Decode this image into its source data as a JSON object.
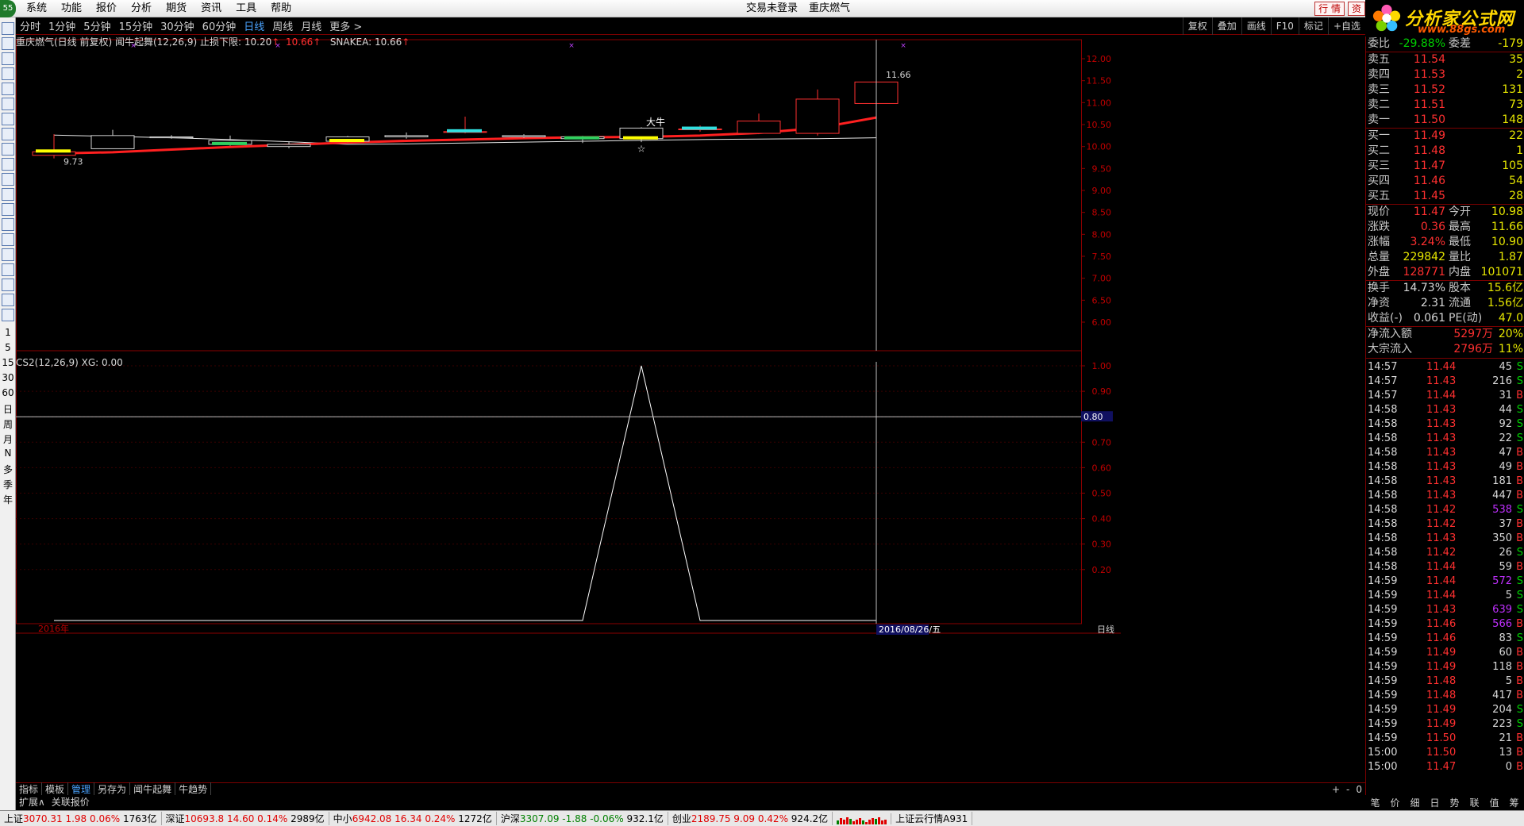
{
  "menubar": {
    "badge": "55",
    "items": [
      "系统",
      "功能",
      "报价",
      "分析",
      "期货",
      "资讯",
      "工具",
      "帮助"
    ],
    "login_status": "交易未登录",
    "stock_name": "重庆燃气",
    "right_buttons": [
      "行 情",
      "资"
    ]
  },
  "logo": {
    "title": "分析家公式网",
    "url": "www.88gs.com"
  },
  "periodbar": {
    "periods": [
      "分时",
      "1分钟",
      "5分钟",
      "15分钟",
      "30分钟",
      "60分钟",
      "日线",
      "周线",
      "月线",
      "更多 >"
    ],
    "active_index": 6,
    "right_tools": [
      "复权",
      "叠加",
      "画线",
      "F10",
      "标记",
      "+自选"
    ]
  },
  "lefttool": {
    "labels": [
      "1",
      "5",
      "15",
      "30",
      "60",
      "日",
      "周",
      "月",
      "N",
      "多",
      "季",
      "年"
    ],
    "icon_names": [
      "cursor-icon",
      "arrow-down-icon",
      "zoom-icon",
      "grid-icon",
      "line-chart-icon",
      "kline-icon",
      "table-icon",
      "f10-icon",
      "f10b-icon",
      "news-icon",
      "f10c-icon",
      "f10d-icon",
      "gauge-icon",
      "trend-icon",
      "rsi-icon",
      "money-icon",
      "move-icon",
      "pencil-icon",
      "fs-icon",
      "refresh-icon"
    ]
  },
  "main_chart": {
    "info": {
      "title": "重庆燃气(日线 前复权) 闻牛起舞(12,26,9)",
      "stop_loss_label": "止损下限:",
      "stop_loss_value": "10.20",
      "value2": "10.66",
      "snake_label": "SNAKEA:",
      "snake_value": "10.66"
    },
    "high_label": "11.66",
    "low_label": "9.73",
    "signal_label": "大牛",
    "y_ticks": [
      "12.00",
      "11.50",
      "11.00",
      "10.50",
      "10.00",
      "9.50",
      "9.00",
      "8.50",
      "8.00",
      "7.50",
      "7.00",
      "6.50",
      "6.00"
    ]
  },
  "sub_chart": {
    "info": "CS2(12,26,9)  XG: 0.00",
    "y_ticks": [
      "1.00",
      "0.90",
      "0.80",
      "0.70",
      "0.60",
      "0.50",
      "0.40",
      "0.30",
      "0.20"
    ],
    "cursor_value": "0.80",
    "year_label": "2016年",
    "date_label": "2016/08/26/五",
    "period_label": "日线"
  },
  "chart_data": {
    "type": "candlestick",
    "dates_note": "daily, 2016, cursor at 2016/08/26",
    "ohlc": [
      {
        "o": 9.8,
        "h": 10.28,
        "l": 9.73,
        "c": 9.88
      },
      {
        "o": 10.25,
        "h": 10.38,
        "l": 10.0,
        "c": 9.95
      },
      {
        "o": 10.22,
        "h": 10.26,
        "l": 10.18,
        "c": 10.2
      },
      {
        "o": 10.14,
        "h": 10.25,
        "l": 10.02,
        "c": 10.05
      },
      {
        "o": 10.05,
        "h": 10.12,
        "l": 9.96,
        "c": 10.0
      },
      {
        "o": 10.22,
        "h": 10.24,
        "l": 10.1,
        "c": 10.12
      },
      {
        "o": 10.25,
        "h": 10.32,
        "l": 10.18,
        "c": 10.22
      },
      {
        "o": 10.34,
        "h": 10.68,
        "l": 10.3,
        "c": 10.34
      },
      {
        "o": 10.25,
        "h": 10.28,
        "l": 10.2,
        "c": 10.22
      },
      {
        "o": 10.22,
        "h": 10.24,
        "l": 10.08,
        "c": 10.18
      },
      {
        "o": 10.42,
        "h": 10.44,
        "l": 10.1,
        "c": 10.18
      },
      {
        "o": 10.4,
        "h": 10.48,
        "l": 10.34,
        "c": 10.4
      },
      {
        "o": 10.3,
        "h": 10.75,
        "l": 10.28,
        "c": 10.58
      },
      {
        "o": 10.3,
        "h": 11.3,
        "l": 10.25,
        "c": 11.08
      },
      {
        "o": 10.98,
        "h": 11.66,
        "l": 10.9,
        "c": 11.47
      }
    ],
    "snake_line": [
      9.84,
      9.87,
      9.93,
      9.99,
      10.04,
      10.09,
      10.13,
      10.16,
      10.19,
      10.21,
      10.22,
      10.25,
      10.31,
      10.42,
      10.66
    ],
    "stop_loss_line": [
      10.26,
      10.23,
      10.2,
      10.16,
      10.11,
      10.05,
      10.06,
      10.08,
      10.1,
      10.12,
      10.14,
      10.16,
      10.17,
      10.18,
      10.2
    ],
    "xg": [
      0,
      0,
      0,
      0,
      0,
      0,
      0,
      0,
      0,
      0,
      0,
      0,
      0,
      0,
      0
    ],
    "cs2": [
      0,
      0,
      0,
      0,
      0,
      0,
      0,
      0,
      0,
      0,
      1,
      0,
      0,
      0,
      0
    ],
    "ylim_main": [
      6.0,
      12.2
    ],
    "ylim_sub": [
      0,
      1.05
    ]
  },
  "quote": {
    "webi_label": "委比",
    "webi_value": "-29.88%",
    "weicha_label": "委差",
    "weicha_value": "-179",
    "sell": [
      {
        "label": "卖五",
        "price": "11.54",
        "vol": "35"
      },
      {
        "label": "卖四",
        "price": "11.53",
        "vol": "2"
      },
      {
        "label": "卖三",
        "price": "11.52",
        "vol": "131"
      },
      {
        "label": "卖二",
        "price": "11.51",
        "vol": "73"
      },
      {
        "label": "卖一",
        "price": "11.50",
        "vol": "148"
      }
    ],
    "buy": [
      {
        "label": "买一",
        "price": "11.49",
        "vol": "22"
      },
      {
        "label": "买二",
        "price": "11.48",
        "vol": "1"
      },
      {
        "label": "买三",
        "price": "11.47",
        "vol": "105"
      },
      {
        "label": "买四",
        "price": "11.46",
        "vol": "54"
      },
      {
        "label": "买五",
        "price": "11.45",
        "vol": "28"
      }
    ],
    "stats": [
      {
        "l1": "现价",
        "v1": "11.47",
        "l2": "今开",
        "v2": "10.98",
        "c1": "c-red",
        "c2": "c-red"
      },
      {
        "l1": "涨跌",
        "v1": "0.36",
        "l2": "最高",
        "v2": "11.66",
        "c1": "c-red",
        "c2": "c-red"
      },
      {
        "l1": "涨幅",
        "v1": "3.24%",
        "l2": "最低",
        "v2": "10.90",
        "c1": "c-red",
        "c2": "c-green"
      },
      {
        "l1": "总量",
        "v1": "229842",
        "l2": "量比",
        "v2": "1.87",
        "c1": "c-yellow",
        "c2": "c-red"
      },
      {
        "l1": "外盘",
        "v1": "128771",
        "l2": "内盘",
        "v2": "101071",
        "c1": "c-red",
        "c2": "c-green"
      }
    ],
    "stats2": [
      {
        "l1": "换手",
        "v1": "14.73%",
        "l2": "股本",
        "v2": "15.6亿",
        "c1": "c-white",
        "c2": "c-white"
      },
      {
        "l1": "净资",
        "v1": "2.31",
        "l2": "流通",
        "v2": "1.56亿",
        "c1": "c-white",
        "c2": "c-white"
      },
      {
        "l1": "收益(-)",
        "v1": "0.061",
        "l2": "PE(动)",
        "v2": "47.0",
        "c1": "c-white",
        "c2": "c-white"
      }
    ],
    "flows": [
      {
        "label": "净流入额",
        "value": "5297万",
        "pct": "20%"
      },
      {
        "label": "大宗流入",
        "value": "2796万",
        "pct": "11%"
      }
    ],
    "ticks": [
      {
        "t": "14:57",
        "p": "11.44",
        "v": "45",
        "d": "S",
        "pc": "c-red",
        "vc": "c-white"
      },
      {
        "t": "14:57",
        "p": "11.43",
        "v": "216",
        "d": "S",
        "pc": "c-red",
        "vc": "c-white"
      },
      {
        "t": "14:57",
        "p": "11.44",
        "v": "31",
        "d": "B",
        "pc": "c-red",
        "vc": "c-white"
      },
      {
        "t": "14:58",
        "p": "11.43",
        "v": "44",
        "d": "S",
        "pc": "c-red",
        "vc": "c-white"
      },
      {
        "t": "14:58",
        "p": "11.43",
        "v": "92",
        "d": "S",
        "pc": "c-red",
        "vc": "c-white"
      },
      {
        "t": "14:58",
        "p": "11.43",
        "v": "22",
        "d": "S",
        "pc": "c-red",
        "vc": "c-white"
      },
      {
        "t": "14:58",
        "p": "11.43",
        "v": "47",
        "d": "B",
        "pc": "c-red",
        "vc": "c-white"
      },
      {
        "t": "14:58",
        "p": "11.43",
        "v": "49",
        "d": "B",
        "pc": "c-red",
        "vc": "c-white"
      },
      {
        "t": "14:58",
        "p": "11.43",
        "v": "181",
        "d": "B",
        "pc": "c-red",
        "vc": "c-white"
      },
      {
        "t": "14:58",
        "p": "11.43",
        "v": "447",
        "d": "B",
        "pc": "c-red",
        "vc": "c-white"
      },
      {
        "t": "14:58",
        "p": "11.42",
        "v": "538",
        "d": "S",
        "pc": "c-red",
        "vc": "c-purple"
      },
      {
        "t": "14:58",
        "p": "11.42",
        "v": "37",
        "d": "B",
        "pc": "c-red",
        "vc": "c-white"
      },
      {
        "t": "14:58",
        "p": "11.43",
        "v": "350",
        "d": "B",
        "pc": "c-red",
        "vc": "c-white"
      },
      {
        "t": "14:58",
        "p": "11.42",
        "v": "26",
        "d": "S",
        "pc": "c-red",
        "vc": "c-white"
      },
      {
        "t": "14:58",
        "p": "11.44",
        "v": "59",
        "d": "B",
        "pc": "c-red",
        "vc": "c-white"
      },
      {
        "t": "14:59",
        "p": "11.44",
        "v": "572",
        "d": "S",
        "pc": "c-red",
        "vc": "c-purple"
      },
      {
        "t": "14:59",
        "p": "11.44",
        "v": "5",
        "d": "S",
        "pc": "c-red",
        "vc": "c-white"
      },
      {
        "t": "14:59",
        "p": "11.43",
        "v": "639",
        "d": "S",
        "pc": "c-red",
        "vc": "c-purple"
      },
      {
        "t": "14:59",
        "p": "11.46",
        "v": "566",
        "d": "B",
        "pc": "c-red",
        "vc": "c-purple"
      },
      {
        "t": "14:59",
        "p": "11.46",
        "v": "83",
        "d": "S",
        "pc": "c-red",
        "vc": "c-white"
      },
      {
        "t": "14:59",
        "p": "11.49",
        "v": "60",
        "d": "B",
        "pc": "c-red",
        "vc": "c-white"
      },
      {
        "t": "14:59",
        "p": "11.49",
        "v": "118",
        "d": "B",
        "pc": "c-red",
        "vc": "c-white"
      },
      {
        "t": "14:59",
        "p": "11.48",
        "v": "5",
        "d": "B",
        "pc": "c-red",
        "vc": "c-white"
      },
      {
        "t": "14:59",
        "p": "11.48",
        "v": "417",
        "d": "B",
        "pc": "c-red",
        "vc": "c-white"
      },
      {
        "t": "14:59",
        "p": "11.49",
        "v": "204",
        "d": "S",
        "pc": "c-red",
        "vc": "c-white"
      },
      {
        "t": "14:59",
        "p": "11.49",
        "v": "223",
        "d": "S",
        "pc": "c-red",
        "vc": "c-white"
      },
      {
        "t": "14:59",
        "p": "11.50",
        "v": "21",
        "d": "B",
        "pc": "c-red",
        "vc": "c-white"
      },
      {
        "t": "15:00",
        "p": "11.50",
        "v": "13",
        "d": "B",
        "pc": "c-red",
        "vc": "c-white"
      },
      {
        "t": "15:00",
        "p": "11.47",
        "v": "0",
        "d": "B",
        "pc": "c-red",
        "vc": "c-white"
      }
    ],
    "tabs": [
      "笔",
      "价",
      "细",
      "日",
      "势",
      "联",
      "值",
      "筹"
    ]
  },
  "bottomtabs": [
    "指标",
    "模板",
    "管理",
    "另存为",
    "闻牛起舞",
    "牛趋势"
  ],
  "bottomtabs_active": 2,
  "subtabs": [
    "扩展∧",
    "关联报价"
  ],
  "zoom_controls": [
    "+",
    "-",
    "0"
  ],
  "statusbar": [
    {
      "name": "上证",
      "value": "3070.31",
      "change": "1.98",
      "pct": "0.06%",
      "amt": "1763亿"
    },
    {
      "name": "深证",
      "value": "10693.8",
      "change": "14.60",
      "pct": "0.14%",
      "amt": "2989亿"
    },
    {
      "name": "中小",
      "value": "6942.08",
      "change": "16.34",
      "pct": "0.24%",
      "amt": "1272亿"
    },
    {
      "name": "沪深",
      "value": "3307.09",
      "change": "-1.88",
      "pct": "-0.06%",
      "amt": "932.1亿"
    },
    {
      "name": "创业",
      "value": "2189.75",
      "change": "9.09",
      "pct": "0.42%",
      "amt": "924.2亿"
    }
  ],
  "status_right": "上证云行情A931",
  "colors": {
    "up": "#ff3030",
    "down": "#00d000",
    "snake": "#ff2020",
    "stop": "#e8e8e8",
    "grid_border": "#8a0000",
    "sub_line": "#ffffff",
    "cursor": "#c0c0c0",
    "yellow_bar": "#ffff00",
    "cyan_bar": "#30e0e0"
  }
}
